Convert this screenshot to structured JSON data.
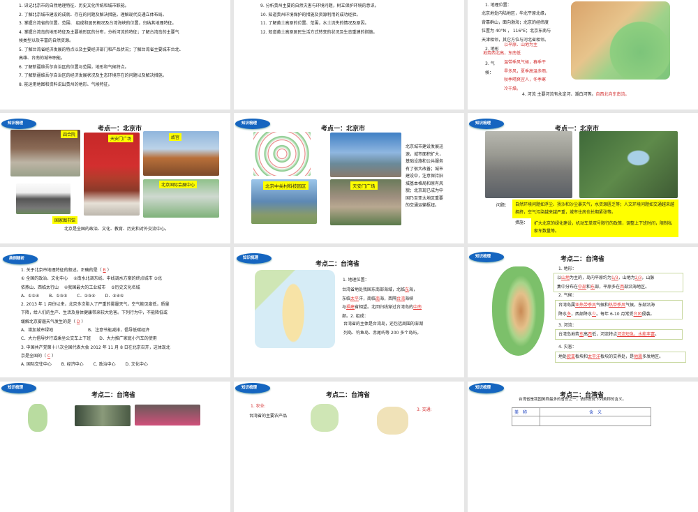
{
  "slide1": {
    "lines": [
      "1. 识记北京市的自然地理特征、历史文化传统和城市职能。",
      "2. 了解北京城市建设的成就、存在的问题及解决措施，理解现代交通立体布局。",
      "3. 掌握台湾省的位置、范围、 组成和居民概况及台湾海峡的位置，归纳其地理特征。",
      "4. 掌握台湾岛的地形特征及主要地形区的分布，分析河流的特征；了解台湾岛的主要气",
      "候类型以及丰富的自然资源。",
      "5. 了解台湾省经济发展的特点以及主要经济部门和产品状况；了解台湾省主要城市台北、",
      "高雄、台南的城市职能。",
      "6. 了解新疆维吾尔自治区的位置与范围，地形和气候特点。",
      "7. 了解新疆维吾尔自治区的经济发展状况及生态环境存在的问题以及解决措施。",
      "8. 能运用地图和资料说出贵州的地形、气候特征。"
    ]
  },
  "slide2": {
    "lines": [
      "9. 分析贵州主要的自然灾害与环境问题，树立保护环境的意识。",
      "10. 知道贵州环境保护的措施及资源利用的成功经验。",
      "11. 了解黄土高原的位置、范围，水土流失的情况及原因。",
      "12. 知道黄土高原居民生活方式转变的状况及生态重建的措施。"
    ]
  },
  "slide3": {
    "heading1": "1. 地理位置：",
    "loc_lines": [
      "北京地处内陆地区，华北平原北缘，",
      "背靠群山，面向渤海；北京的经纬度",
      "位置为 40°N ， 116°E；北京东南与",
      "天津相邻，其它方位与河北省相邻。"
    ],
    "terrain_label": "2. 地形",
    "terrain_answers": [
      "以平原、山地为主",
      "地势西北高，东南低"
    ],
    "climate_label": "3. 气候：",
    "climate_answers": [
      "温带季风气候，春季干",
      "旱多风，夏季高温多雨，",
      "秋季晴爽宜人，冬季寒",
      "冷干燥。"
    ],
    "river_text": "4. 河流 主要河流有永定河、潮白河等。",
    "river_answer": "自西北向东南流。"
  },
  "badges": {
    "knowledge": "知识梳理",
    "examples": "典例精析"
  },
  "titles": {
    "beijing": "考点一：北京市",
    "taiwan": "考点二：台湾省"
  },
  "slide4": {
    "labels": [
      "四合院",
      "天安门广场",
      "故宫",
      "北京国际会展中心",
      "国家图书馆"
    ],
    "caption": "北京是全国的政治、文化、教育、历史和对外交流中心。"
  },
  "slide5": {
    "labels": [
      "北京中关村科技园区",
      "天安门广场"
    ],
    "text_lines": [
      "北京城市建设发展迅",
      "速，城市面积扩大，",
      "基础设施和公共服务",
      "有了很大改善；城市",
      "建设中，注意保持旧",
      "城基本格局和原有风",
      "貌；北京现已成为中",
      "国乃至亚太地区重要",
      "的交通运输枢纽。"
    ]
  },
  "slide6": {
    "problem_label": "问题：",
    "problem_text": "自然环境问题如浮尘、扬沙和沙尘暴天气，水资源匮乏等；人文环境问题如交通越来越拥挤，空气污染越来越严重，城市住房也长期紧张等。",
    "measure_label": "措施：",
    "measure_text": "扩大北京的绿化建设，机动车单双号限行的政策，调整上下班时间，限制私家车数量等。"
  },
  "slide7": {
    "lines": [
      [
        {
          "t": "1. 关于北京市地理特征的叙述，正确的是（ "
        },
        {
          "t": "B",
          "a": 1
        },
        {
          "t": " ）"
        }
      ],
      [
        {
          "t": "① 全国的政治、文化中心　 ②南水北调东线、中线调水方案的终点城市 ③北"
        }
      ],
      [
        {
          "t": "依燕山、西临太行山　 ④我国最大的工业城市　 ⑤历史文化名城"
        }
      ],
      [
        {
          "t": "A．①②④　　 B．①③⑤　　 C．②③④　　 D．③④⑤"
        }
      ],
      [
        {
          "t": "2. 2013 年 1 月份以来，北京多次陷入了严重的雾霾天气，空气能见度低，质量"
        }
      ],
      [
        {
          "t": "下降，给人们的生产、生活及身体健康带来较大危害。下列行为中，不能降低或"
        }
      ],
      [
        {
          "t": "缓解北京雾霾天气发生的是（ "
        },
        {
          "t": "D",
          "a": 1
        },
        {
          "t": " ）"
        }
      ],
      [
        {
          "t": "A．增加城市绿地　　　　　　　　 B．注意节能减排，倡导低碳经济"
        }
      ],
      [
        {
          "t": "C．大力倡导步行或乘坐公交车上下班　　D．大力推广家庭小汽车的使用"
        }
      ],
      [
        {
          "t": "3. 中国共产党第十八次全国代表大会 2012 年 11 月 8 日在北京召开，这体现北"
        }
      ],
      [
        {
          "t": "京是全国的（ "
        },
        {
          "t": "C",
          "a": 1
        },
        {
          "t": " ）"
        }
      ],
      [
        {
          "t": "A. 国际交往中心　　 B. 经济中心　　 C. 政治中心　　 D. 文化中心"
        }
      ]
    ]
  },
  "slide8": {
    "heading": "1. 地理位置：",
    "lines": [
      [
        {
          "t": "台湾省地处我国东南部海域，北临"
        },
        {
          "t": "东",
          "a": 1
        },
        {
          "t": "海，"
        }
      ],
      [
        {
          "t": "东临"
        },
        {
          "t": "太平",
          "a": 1
        },
        {
          "t": "洋，南临"
        },
        {
          "t": "南",
          "a": 1
        },
        {
          "t": "海，西隔"
        },
        {
          "t": "台湾",
          "a": 1
        },
        {
          "t": "海峡"
        }
      ],
      [
        {
          "t": "与"
        },
        {
          "t": "福建",
          "a": 1
        },
        {
          "t": "省相望。北回归线穿过台湾岛的"
        },
        {
          "t": "中南",
          "a": 1
        }
      ],
      [
        {
          "t": "部。2. 组成："
        }
      ]
    ],
    "composition": [
      "台湾省的主体是台湾岛，还包括周围的澎湖",
      "列岛、钓鱼岛、赤尾屿等 200 多个岛屿。"
    ]
  },
  "slide9": {
    "h1": "1. 地形：",
    "terrain": [
      [
        {
          "t": "以"
        },
        {
          "t": "山地",
          "a": 1
        },
        {
          "t": "为主的，岛内平原约为"
        },
        {
          "t": "1/3",
          "a": 1
        },
        {
          "t": "，山地为"
        },
        {
          "t": "2/3",
          "a": 1
        },
        {
          "t": "，山脉"
        }
      ],
      [
        {
          "t": "集中分布在"
        },
        {
          "t": "中部",
          "a": 1
        },
        {
          "t": "和"
        },
        {
          "t": "东",
          "a": 1
        },
        {
          "t": "部，平原多在"
        },
        {
          "t": "西",
          "a": 1
        },
        {
          "t": "部沿海地区。"
        }
      ]
    ],
    "h2": "2. 气候：",
    "climate": [
      [
        {
          "t": "台湾岛属"
        },
        {
          "t": "亚热带季风",
          "a": 1
        },
        {
          "t": "气候和"
        },
        {
          "t": "热带季风",
          "a": 1
        },
        {
          "t": "气候，东部沿海"
        }
      ],
      [
        {
          "t": "降水"
        },
        {
          "t": "多",
          "a": 1
        },
        {
          "t": "，西部降水"
        },
        {
          "t": "少",
          "a": 1
        },
        {
          "t": "。每年 6-10 月常受"
        },
        {
          "t": "台风",
          "a": 1
        },
        {
          "t": "侵袭。"
        }
      ]
    ],
    "h3": "3. 河流：",
    "river": [
      [
        {
          "t": "台湾岛地势"
        },
        {
          "t": "东",
          "a": 1
        },
        {
          "t": "高"
        },
        {
          "t": "西",
          "a": 1
        },
        {
          "t": "低，河流特点"
        },
        {
          "t": "河流短急，水能丰富",
          "a": 1
        },
        {
          "t": "。"
        }
      ]
    ],
    "h4": "4. 灾害：",
    "disaster": [
      [
        {
          "t": "地处"
        },
        {
          "t": "欧亚",
          "a": 1
        },
        {
          "t": "板块和"
        },
        {
          "t": "太平洋",
          "a": 1
        },
        {
          "t": "板块的交界处，是"
        },
        {
          "t": "地震",
          "a": 1
        },
        {
          "t": "多发地区。"
        }
      ]
    ]
  },
  "slide11": {
    "agri": "1. 农业:",
    "agri_text": "台湾省的主要农产品",
    "transport": "3. 交通:"
  },
  "slide12": {
    "subtitle": "台湾省是我国美称最多的省份之一，请你说说下列美称的含义。",
    "col1": "美　称",
    "col2": "含　义"
  },
  "colors": {
    "badge": "#1565c0",
    "highlight": "#ffff00",
    "answer": "#e53935"
  }
}
